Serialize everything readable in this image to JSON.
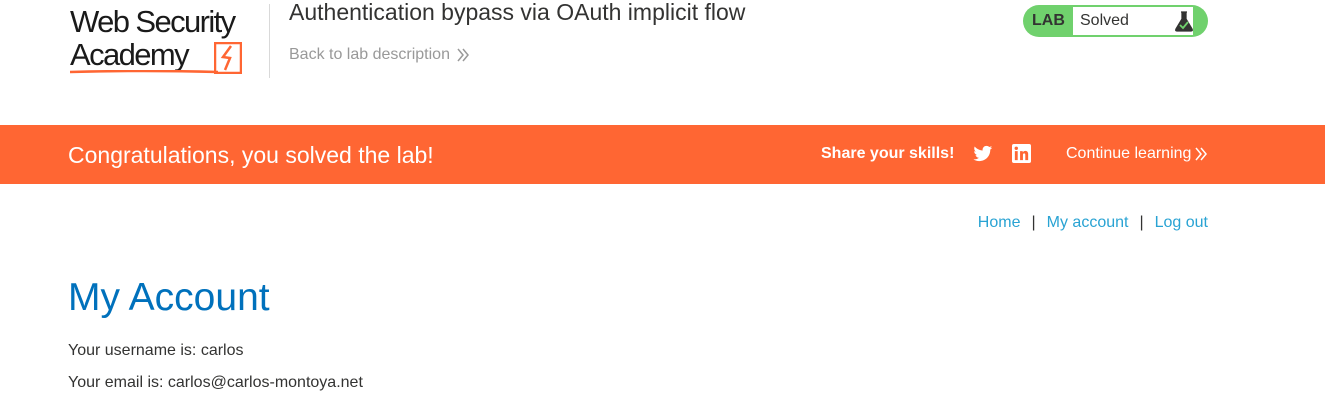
{
  "header": {
    "logo_line1": "Web Security",
    "logo_line2": "Academy",
    "lab_title": "Authentication bypass via OAuth implicit flow",
    "back_link": "Back to lab description",
    "lab_status": {
      "label": "LAB",
      "state": "Solved",
      "icon": "flask-icon"
    }
  },
  "banner": {
    "message": "Congratulations, you solved the lab!",
    "share_label": "Share your skills!",
    "continue_label": "Continue learning",
    "icons": [
      "twitter-icon",
      "linkedin-icon"
    ]
  },
  "nav": {
    "home": "Home",
    "my_account": "My account",
    "log_out": "Log out",
    "separator": "|"
  },
  "main": {
    "title": "My Account",
    "username_text": "Your username is: carlos",
    "email_text": "Your email is: carlos@carlos-montoya.net"
  },
  "colors": {
    "banner": "#ff6633",
    "status_green": "#70d16d",
    "link": "#29a3d3",
    "title": "#0071bc"
  }
}
